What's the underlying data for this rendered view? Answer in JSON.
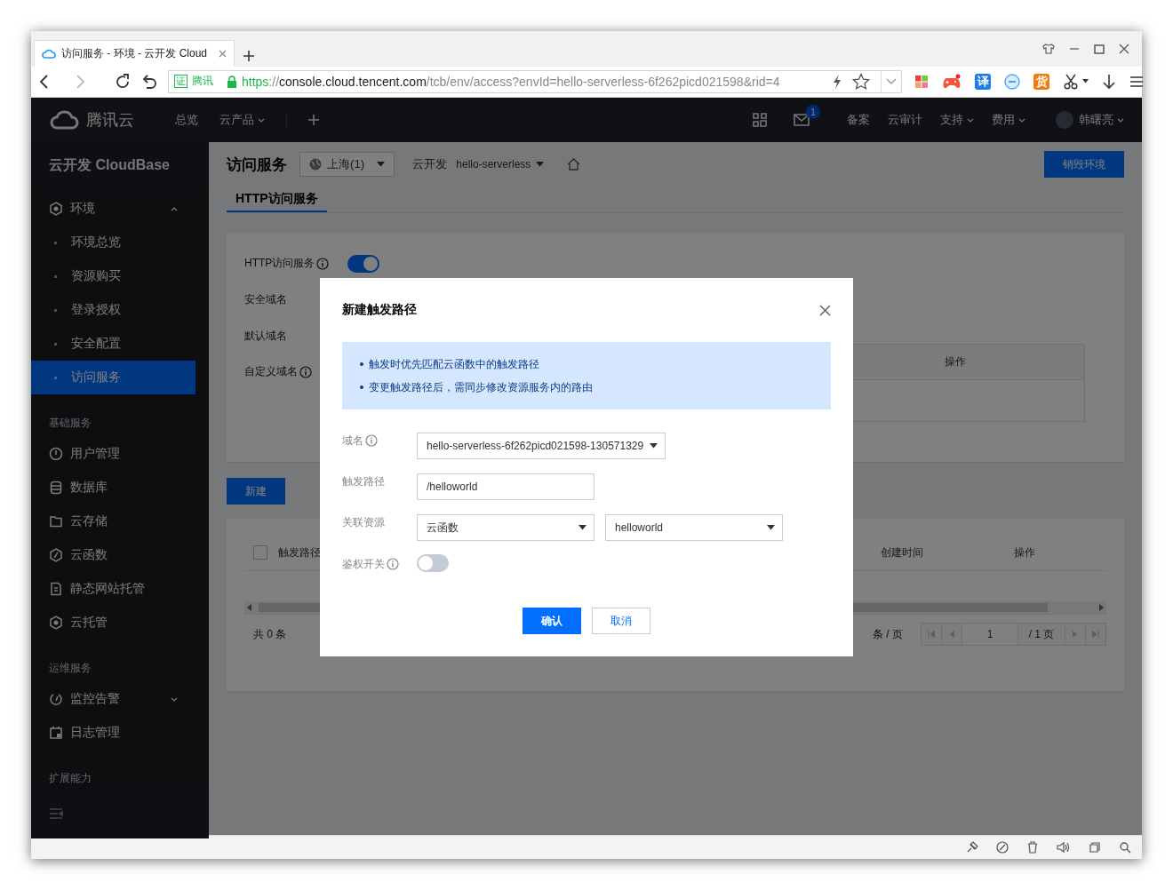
{
  "browser": {
    "tab_title": "访问服务 - 环境 - 云开发 Cloud",
    "cert_mark": "证",
    "cert_label": "腾讯",
    "url_scheme": "https",
    "url_sep": "://",
    "url_host": "console.cloud.tencent.com",
    "url_path": "/tcb/env/access?envId=hello-serverless-6f262picd021598&rid=4",
    "extensions": [
      {
        "kind": "tiles"
      },
      {
        "kind": "gamepad"
      },
      {
        "kind": "letter",
        "text": "译",
        "color": "#1a7fe8"
      },
      {
        "kind": "blocker"
      },
      {
        "kind": "letter",
        "text": "货",
        "color": "#f57c0b"
      },
      {
        "kind": "scissors"
      },
      {
        "kind": "download"
      },
      {
        "kind": "menu"
      }
    ]
  },
  "topnav": {
    "logo_text": "腾讯云",
    "left_items": [
      {
        "label": "总览",
        "dropdown": false
      },
      {
        "label": "云产品",
        "dropdown": true
      }
    ],
    "mail_badge": "1",
    "right_items": [
      {
        "label": "备案",
        "dropdown": false
      },
      {
        "label": "云审计",
        "dropdown": false
      },
      {
        "label": "支持",
        "dropdown": true
      },
      {
        "label": "费用",
        "dropdown": true
      }
    ],
    "user_name": "韩曙亮"
  },
  "sidebar": {
    "title": "云开发 CloudBase",
    "groups": [
      {
        "items": [
          {
            "label": "环境",
            "selected": false,
            "expanded": true,
            "children": [
              {
                "label": "环境总览",
                "selected": false
              },
              {
                "label": "资源购买",
                "selected": false
              },
              {
                "label": "登录授权",
                "selected": false
              },
              {
                "label": "安全配置",
                "selected": false
              },
              {
                "label": "访问服务",
                "selected": true
              }
            ]
          }
        ]
      },
      {
        "heading": "基础服务",
        "items": [
          {
            "label": "用户管理",
            "selected": false
          },
          {
            "label": "数据库",
            "selected": false
          },
          {
            "label": "云存储",
            "selected": false
          },
          {
            "label": "云函数",
            "selected": false
          },
          {
            "label": "静态网站托管",
            "selected": false
          },
          {
            "label": "云托管",
            "selected": false
          }
        ]
      },
      {
        "heading": "运维服务",
        "items": [
          {
            "label": "监控告警",
            "selected": false,
            "expanded": false
          },
          {
            "label": "日志管理",
            "selected": false
          }
        ]
      },
      {
        "heading": "扩展能力"
      }
    ]
  },
  "page": {
    "title": "访问服务",
    "region": "上海(1)",
    "env_label": "云开发",
    "env": "hello-serverless",
    "destroy_button": "销毁环境",
    "tabs": [
      {
        "label": "HTTP访问服务",
        "selected": true
      }
    ],
    "settings": {
      "http_service": {
        "label": "HTTP访问服务",
        "info": true,
        "on": true
      },
      "rows": [
        {
          "label": "安全域名",
          "info": false
        },
        {
          "label": "默认域名",
          "info": false
        },
        {
          "label": "自定义域名",
          "info": true
        }
      ],
      "domain_table_columns": [
        "操作"
      ]
    },
    "create_button": "新建",
    "routes_table": {
      "checked": false,
      "columns": [
        "触发路径",
        "创建时间",
        "操作"
      ],
      "total": "共 0 条",
      "page_size_label": "条 / 页",
      "page": "1",
      "pages": "/ 1 页"
    }
  },
  "dialog": {
    "title": "新建触发路径",
    "notices": [
      "触发时优先匹配云函数中的触发路径",
      "变更触发路径后，需同步修改资源服务内的路由"
    ],
    "fields": [
      {
        "kind": "select",
        "label": "域名",
        "info": true,
        "value": "hello-serverless-6f262picd021598-130571329"
      },
      {
        "kind": "input",
        "label": "触发路径",
        "info": false,
        "value": "/helloworld"
      },
      {
        "kind": "select_pair",
        "label": "关联资源",
        "info": false,
        "values": [
          "云函数",
          "helloworld"
        ]
      },
      {
        "kind": "toggle",
        "label": "鉴权开关",
        "info": true,
        "on": false
      }
    ],
    "buttons": [
      {
        "label": "确认",
        "primary": true
      },
      {
        "label": "取消",
        "primary": false
      }
    ]
  }
}
